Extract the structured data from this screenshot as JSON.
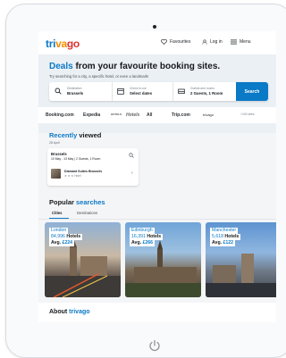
{
  "nav": {
    "logo": {
      "part1": "tri",
      "part2": "va",
      "part3": "go"
    },
    "favourites": "Favourites",
    "login": "Log in",
    "menu": "Menu"
  },
  "hero": {
    "title_accent": "Deals",
    "title_rest": " from your favourite booking sites.",
    "subtitle": "Try searching for a city, a specific hotel, or even a landmark!"
  },
  "search": {
    "destination_label": "Destination",
    "destination_value": "Brussels",
    "dates_label": "Check in-out",
    "dates_value": "Select dates",
    "guests_label": "Guests and rooms",
    "guests_value": "2 Guests, 1 Room",
    "button": "Search"
  },
  "partners": [
    "Booking.com",
    "Expedia",
    "HOTELS",
    "Hotels",
    "All",
    "Trip.com",
    "trivago",
    "+100 sites"
  ],
  "recently_viewed": {
    "title_accent": "Recently",
    "title_rest": " viewed",
    "date": "28 April",
    "city": "Brussels",
    "details": "10 May - 13 May | 2 Guests, 1 Room",
    "hotel": "Diamant Suites Brussels",
    "stars": "★ ★ ★  Hotel"
  },
  "popular": {
    "title_rest": "Popular ",
    "title_accent": "searches",
    "tabs": [
      "Cities",
      "Destinations"
    ],
    "destinations": [
      {
        "name": "London",
        "hotels": "84,996",
        "hotels_word": " Hotels",
        "avg_word": "Avg. ",
        "avg": "£224"
      },
      {
        "name": "Edinburgh",
        "hotels": "16,391",
        "hotels_word": " Hotels",
        "avg_word": "Avg. ",
        "avg": "£266"
      },
      {
        "name": "Manchester",
        "hotels": "5,618",
        "hotels_word": " Hotels",
        "avg_word": "Avg. ",
        "avg": "£122"
      }
    ]
  },
  "about": {
    "title_rest": "About ",
    "title_accent": "trivago"
  },
  "colors": {
    "brand_blue": "#0a79c6",
    "brand_orange": "#f48f00",
    "brand_red": "#d9322e"
  }
}
